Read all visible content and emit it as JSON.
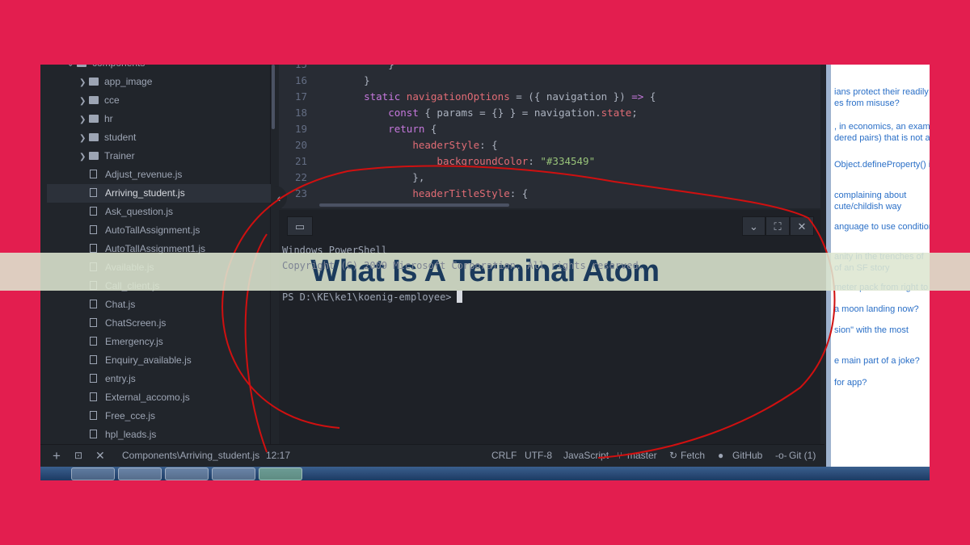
{
  "sidebar": {
    "items": [
      {
        "label": "components",
        "type": "folder-open"
      },
      {
        "label": "app_image",
        "type": "folder"
      },
      {
        "label": "cce",
        "type": "folder"
      },
      {
        "label": "hr",
        "type": "folder"
      },
      {
        "label": "student",
        "type": "folder"
      },
      {
        "label": "Trainer",
        "type": "folder"
      },
      {
        "label": "Adjust_revenue.js",
        "type": "file"
      },
      {
        "label": "Arriving_student.js",
        "type": "file",
        "selected": true
      },
      {
        "label": "Ask_question.js",
        "type": "file"
      },
      {
        "label": "AutoTallAssignment.js",
        "type": "file"
      },
      {
        "label": "AutoTallAssignment1.js",
        "type": "file"
      },
      {
        "label": "Available.js",
        "type": "file"
      },
      {
        "label": "Call_client.js",
        "type": "file"
      },
      {
        "label": "Chat.js",
        "type": "file"
      },
      {
        "label": "ChatScreen.js",
        "type": "file"
      },
      {
        "label": "Emergency.js",
        "type": "file"
      },
      {
        "label": "Enquiry_available.js",
        "type": "file"
      },
      {
        "label": "entry.js",
        "type": "file"
      },
      {
        "label": "External_accomo.js",
        "type": "file"
      },
      {
        "label": "Free_cce.js",
        "type": "file"
      },
      {
        "label": "hpl_leads.js",
        "type": "file"
      }
    ]
  },
  "editor": {
    "lines": [
      {
        "n": "15",
        "html": "        <span class='p'>}</span>"
      },
      {
        "n": "16",
        "html": "    <span class='p'>}</span>"
      },
      {
        "n": "17",
        "html": "    <span class='k'>static</span> <span class='f'>navigationOptions</span> = ({ navigation }) <span class='k'>=&gt;</span> {"
      },
      {
        "n": "18",
        "html": "        <span class='k'>const</span> { params = {} } = navigation.<span class='f'>state</span>;"
      },
      {
        "n": "19",
        "html": "        <span class='k'>return</span> {"
      },
      {
        "n": "20",
        "html": "            <span class='f'>headerStyle</span>: {"
      },
      {
        "n": "21",
        "html": "                <span class='f'>backgroundColor</span>: <span class='s'>\"#334549\"</span>"
      },
      {
        "n": "22",
        "html": "            },"
      },
      {
        "n": "23",
        "html": "            <span class='f'>headerTitleStyle</span>: {"
      }
    ]
  },
  "terminal": {
    "lines": [
      "Windows PowerShell",
      "Copyright (C) 2009 Microsoft Corporation. All rights reserved."
    ],
    "prompt": "PS D:\\KE\\ke1\\koenig-employee>"
  },
  "status": {
    "file": "Components\\Arriving_student.js",
    "cursor": "12:17",
    "line_ending": "CRLF",
    "encoding": "UTF-8",
    "grammar": "JavaScript",
    "branch": "master",
    "fetch": "Fetch",
    "github": "GitHub",
    "git": "Git (1)"
  },
  "web": {
    "questions": [
      "ians protect their readily",
      "es from misuse?",
      ", in economics, an exam",
      "dered pairs) that is not a",
      "Object.defineProperty() i",
      "complaining about",
      "cute/childish way",
      "anguage to use conditiona",
      "anity in the trenches of",
      "of an SF story",
      "meter pack from right to",
      "a moon landing now?",
      "sion\" with the most",
      "e main part of a joke?",
      "for app?"
    ]
  },
  "banner": {
    "title": "What Is A Terminal Atom"
  },
  "colors": {
    "background": "#e31e4f",
    "title": "#1b3a5c",
    "banner": "#dde6d0",
    "annotation": "#d01010"
  }
}
